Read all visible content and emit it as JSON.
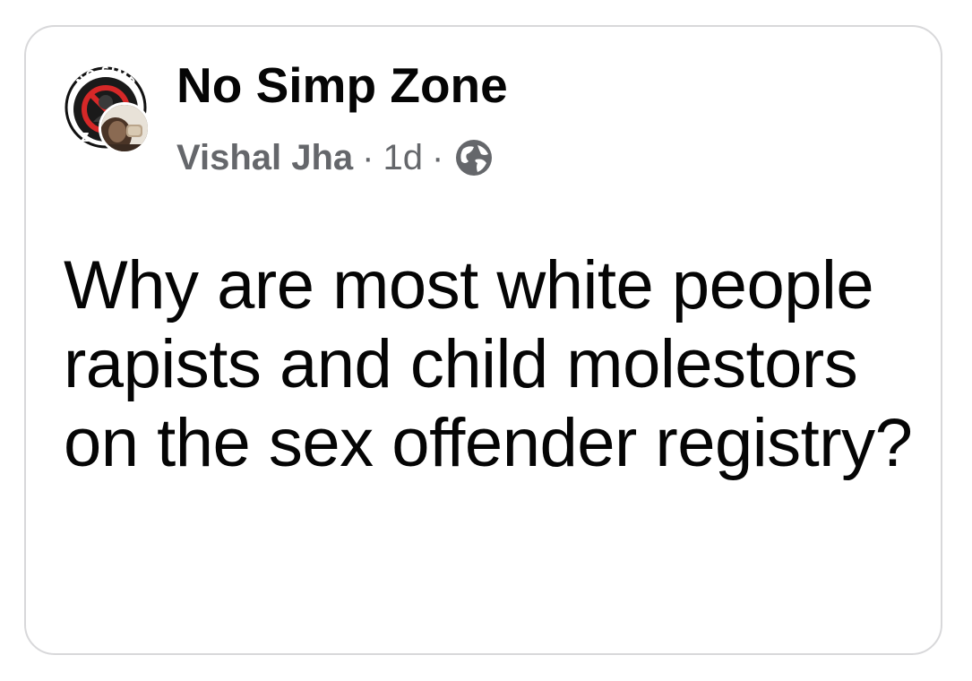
{
  "post": {
    "group_name": "No Simp Zone",
    "group_logo_text": "NO SIMP",
    "group_logo_text_bottom": "Z",
    "author": "Vishal Jha",
    "separator": "·",
    "time": "1d",
    "privacy_icon": "globe-icon",
    "body": "Why are most white people rapists and child molestors on the sex offender registry?"
  },
  "colors": {
    "card_border": "#d8d8da",
    "meta_text": "#65676b",
    "primary_text": "#050505",
    "logo_red": "#d62828"
  }
}
